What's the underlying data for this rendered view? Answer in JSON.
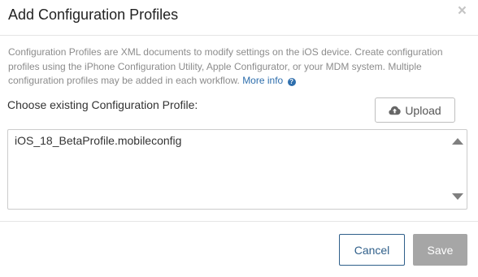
{
  "dialog": {
    "title": "Add Configuration Profiles",
    "close_glyph": "×"
  },
  "description": {
    "text": "Configuration Profiles are XML documents to modify settings on the iOS device. Create configuration profiles using the iPhone Configuration Utility, Apple Configurator, or your MDM system. Multiple configuration profiles may be added in each workflow.",
    "more_info_label": "More info",
    "help_glyph": "?"
  },
  "chooser": {
    "label": "Choose existing Configuration Profile:",
    "upload_label": "Upload",
    "items": [
      "iOS_18_BetaProfile.mobileconfig"
    ]
  },
  "footer": {
    "cancel_label": "Cancel",
    "save_label": "Save"
  },
  "colors": {
    "link": "#2f6fad",
    "cancel_border": "#2f5f8a",
    "save_disabled_bg": "#a6a6a6"
  },
  "icons": {
    "upload": "cloud-upload-icon",
    "help": "question-circle-icon",
    "close": "close-icon"
  }
}
